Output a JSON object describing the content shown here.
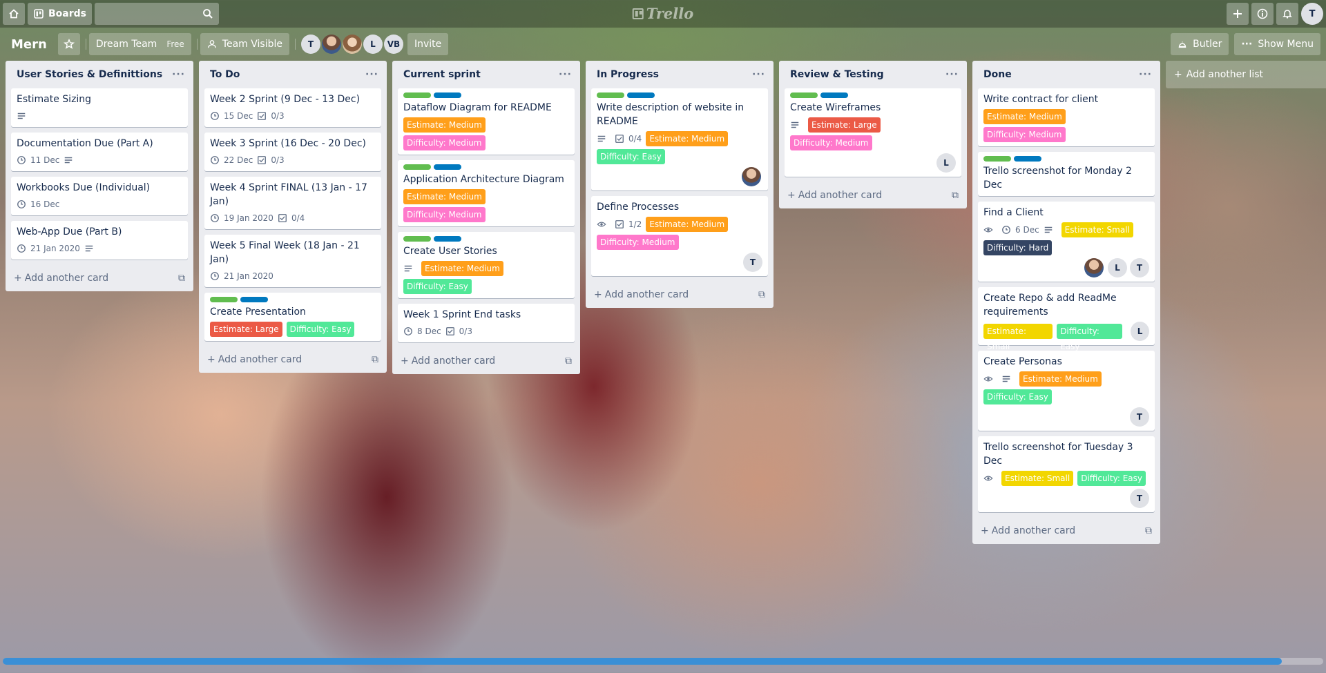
{
  "header": {
    "boards_label": "Boards",
    "search_placeholder": "",
    "logo_text": "Trello",
    "user_initial": "T"
  },
  "board": {
    "name": "Mern",
    "team_label": "Dream Team",
    "team_tag": "Free",
    "visibility_label": "Team Visible",
    "members": [
      "T",
      "",
      "",
      "L",
      "VB"
    ],
    "invite_label": "Invite",
    "butler_label": "Butler",
    "show_menu_label": "Show Menu"
  },
  "colors": {
    "strip_green": "#61bd4f",
    "strip_blue": "#0079bf",
    "label_orange": "#ff9f1a",
    "label_pink": "#ff78cb",
    "label_green": "#51e898",
    "label_red": "#eb5a46",
    "label_yellow": "#f2d600",
    "label_navy": "#344563",
    "scrollbar": "#3a8fd6"
  },
  "add_card_label": "Add another card",
  "add_list_label": "Add another list",
  "lists": [
    {
      "title": "User Stories & Definittions",
      "cards": [
        {
          "title": "Estimate Sizing"
        },
        {
          "title": "Documentation Due (Part A)",
          "date": "11 Dec"
        },
        {
          "title": "Workbooks Due (Individual)",
          "date": "16 Dec"
        },
        {
          "title": "Web-App Due (Part B)",
          "date": "21 Jan 2020"
        }
      ]
    },
    {
      "title": "To Do",
      "cards": [
        {
          "title": "Week 2 Sprint (9 Dec - 13 Dec)",
          "date": "15 Dec",
          "checklist": "0/3"
        },
        {
          "title": "Week 3 Sprint (16 Dec - 20 Dec)",
          "date": "22 Dec",
          "checklist": "0/3"
        },
        {
          "title": "Week 4 Sprint FINAL (13 Jan - 17 Jan)",
          "date": "19 Jan 2020",
          "checklist": "0/4"
        },
        {
          "title": "Week 5 Final Week (18 Jan - 21 Jan)",
          "date": "21 Jan 2020"
        },
        {
          "title": "Create Presentation",
          "labels": [
            "Estimate: Large",
            "Difficulty: Easy"
          ]
        }
      ]
    },
    {
      "title": "Current sprint",
      "cards": [
        {
          "title": "Dataflow Diagram for README",
          "labels": [
            "Estimate: Medium",
            "Difficulty: Medium"
          ]
        },
        {
          "title": "Application Architecture Diagram",
          "labels": [
            "Estimate: Medium",
            "Difficulty: Medium"
          ]
        },
        {
          "title": "Create User Stories",
          "labels": [
            "Estimate: Medium",
            "Difficulty: Easy"
          ]
        },
        {
          "title": "Week 1 Sprint End tasks",
          "date": "8 Dec",
          "checklist": "0/3"
        }
      ]
    },
    {
      "title": "In Progress",
      "cards": [
        {
          "title": "Write description of website in README",
          "checklist": "0/4",
          "labels": [
            "Estimate: Medium",
            "Difficulty: Easy"
          ]
        },
        {
          "title": "Define Processes",
          "checklist": "1/2",
          "labels": [
            "Estimate: Medium",
            "Difficulty: Medium"
          ],
          "member": "T"
        }
      ]
    },
    {
      "title": "Review & Testing",
      "cards": [
        {
          "title": "Create Wireframes",
          "labels": [
            "Estimate: Large",
            "Difficulty: Medium"
          ],
          "member": "L"
        }
      ]
    },
    {
      "title": "Done",
      "cards": [
        {
          "title": "Write contract for client",
          "labels": [
            "Estimate: Medium",
            "Difficulty: Medium"
          ]
        },
        {
          "title": "Trello screenshot for Monday 2 Dec"
        },
        {
          "title": "Find a Client",
          "date": "6 Dec",
          "labels": [
            "Estimate: Small",
            "Difficulty: Hard"
          ],
          "members": [
            "L",
            "T"
          ]
        },
        {
          "title": "Create Repo & add ReadMe requirements",
          "labels": [
            "Estimate: Small",
            "Difficulty: Easy"
          ],
          "member": "L"
        },
        {
          "title": "Create Personas",
          "labels": [
            "Estimate: Medium",
            "Difficulty: Easy"
          ],
          "member": "T"
        },
        {
          "title": "Trello screenshot for Tuesday 3 Dec",
          "labels": [
            "Estimate: Small",
            "Difficulty: Easy"
          ],
          "member": "T"
        }
      ]
    }
  ]
}
